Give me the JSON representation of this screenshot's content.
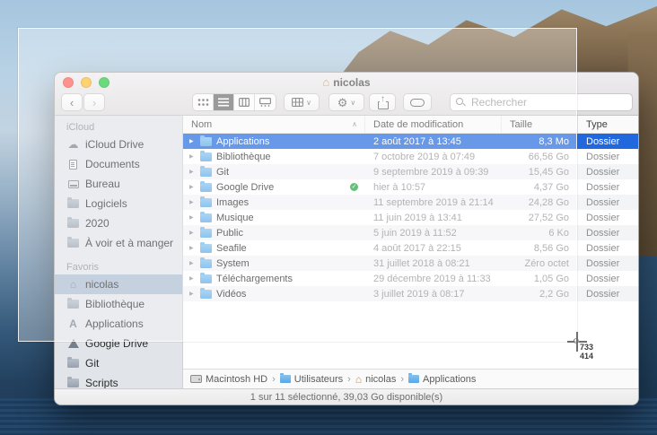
{
  "icons": {
    "back": "‹",
    "forward": "›",
    "gear": "⚙",
    "chevron_down": "∨",
    "home": "⌂",
    "cloud": "☁",
    "disclosure": "▶",
    "sort_asc": "∧",
    "separator": "›",
    "check": "✓",
    "app_a": "A"
  },
  "capture": {
    "width_label": "733",
    "height_label": "414"
  },
  "window": {
    "title": "nicolas",
    "toolbar": {
      "search_placeholder": "Rechercher"
    },
    "sidebar": {
      "sections": [
        {
          "label": "iCloud",
          "items": [
            {
              "label": "iCloud Drive"
            },
            {
              "label": "Documents"
            },
            {
              "label": "Bureau"
            },
            {
              "label": "Logiciels"
            },
            {
              "label": "2020"
            },
            {
              "label": "À voir et à manger"
            }
          ]
        },
        {
          "label": "Favoris",
          "items": [
            {
              "label": "nicolas",
              "selected": true
            },
            {
              "label": "Bibliothèque"
            },
            {
              "label": "Applications"
            },
            {
              "label": "Google Drive"
            },
            {
              "label": "Git"
            },
            {
              "label": "Scripts"
            }
          ]
        }
      ]
    },
    "table": {
      "columns": {
        "name": "Nom",
        "date": "Date de modification",
        "size": "Taille",
        "type": "Type"
      },
      "rows": [
        {
          "name": "Applications",
          "date": "2 août 2017 à 13:45",
          "size": "8,3 Mo",
          "type": "Dossier",
          "selected": true
        },
        {
          "name": "Bibliothèque",
          "date": "7 octobre 2019 à 07:49",
          "size": "66,56 Go",
          "type": "Dossier"
        },
        {
          "name": "Git",
          "date": "9 septembre 2019 à 09:39",
          "size": "15,45 Go",
          "type": "Dossier"
        },
        {
          "name": "Google Drive",
          "date": "hier à 10:57",
          "size": "4,37 Go",
          "type": "Dossier",
          "badge": "synced"
        },
        {
          "name": "Images",
          "date": "11 septembre 2019 à 21:14",
          "size": "24,28 Go",
          "type": "Dossier"
        },
        {
          "name": "Musique",
          "date": "11 juin 2019 à 13:41",
          "size": "27,52 Go",
          "type": "Dossier"
        },
        {
          "name": "Public",
          "date": "5 juin 2019 à 11:52",
          "size": "6 Ko",
          "type": "Dossier"
        },
        {
          "name": "Seafile",
          "date": "4 août 2017 à 22:15",
          "size": "8,56 Go",
          "type": "Dossier"
        },
        {
          "name": "System",
          "date": "31 juillet 2018 à 08:21",
          "size": "Zéro octet",
          "type": "Dossier"
        },
        {
          "name": "Téléchargements",
          "date": "29 décembre 2019 à 11:33",
          "size": "1,05 Go",
          "type": "Dossier"
        },
        {
          "name": "Vidéos",
          "date": "3 juillet 2019 à 08:17",
          "size": "2,2 Go",
          "type": "Dossier"
        }
      ]
    },
    "pathbar": {
      "items": [
        "Macintosh HD",
        "Utilisateurs",
        "nicolas",
        "Applications"
      ]
    },
    "statusbar": {
      "text": "1 sur 11 sélectionné, 39,03 Go disponible(s)"
    }
  },
  "colors": {
    "selection_blue": "#2167de",
    "sidebar_selection": "#abbcd1",
    "folder_blue": "#5ba6e4",
    "badge_green": "#1fa03c",
    "traffic_red": "#ff5f57",
    "traffic_yellow": "#febc2e",
    "traffic_green": "#28c840",
    "row_stripe": "#f3f4f6"
  }
}
